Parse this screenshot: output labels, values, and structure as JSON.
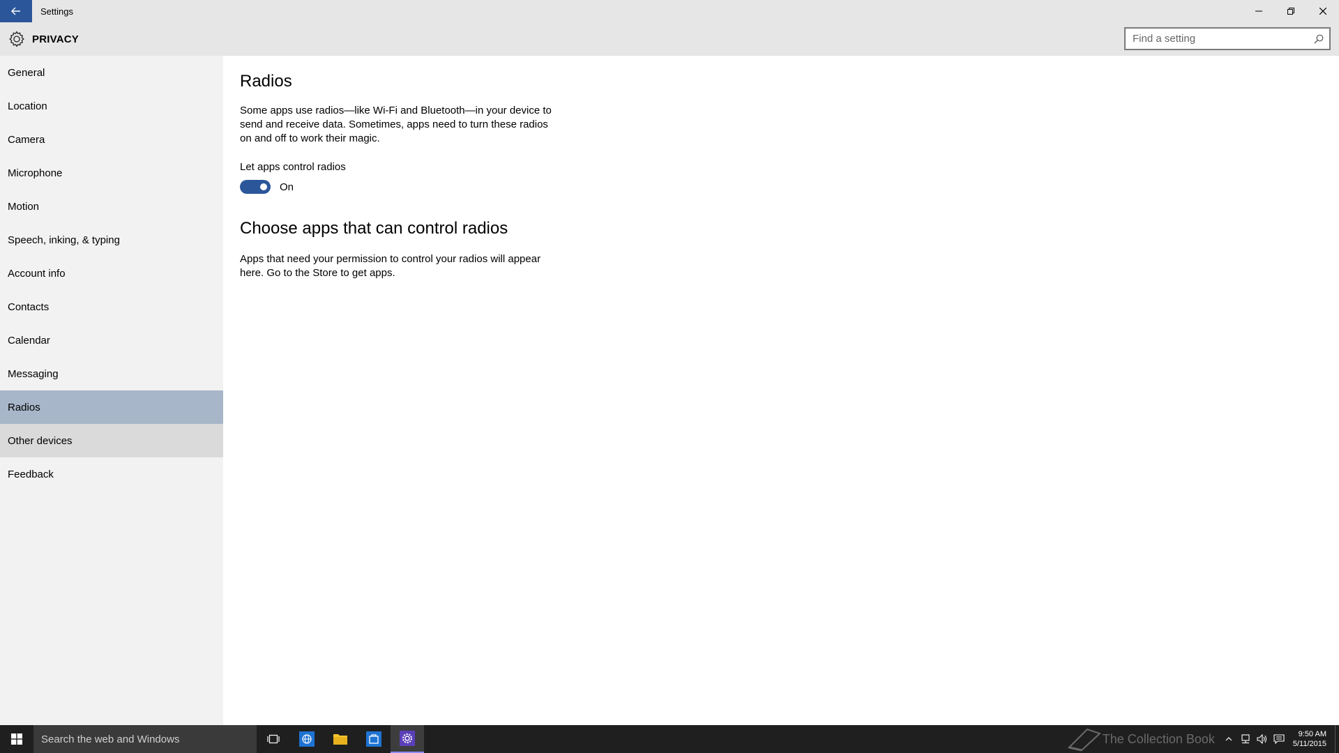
{
  "window": {
    "title": "Settings"
  },
  "header": {
    "title": "PRIVACY",
    "search_placeholder": "Find a setting"
  },
  "sidebar": {
    "items": [
      {
        "label": "General"
      },
      {
        "label": "Location"
      },
      {
        "label": "Camera"
      },
      {
        "label": "Microphone"
      },
      {
        "label": "Motion"
      },
      {
        "label": "Speech, inking, & typing"
      },
      {
        "label": "Account info"
      },
      {
        "label": "Contacts"
      },
      {
        "label": "Calendar"
      },
      {
        "label": "Messaging"
      },
      {
        "label": "Radios"
      },
      {
        "label": "Other devices"
      },
      {
        "label": "Feedback"
      }
    ],
    "selected": "Radios",
    "hovered": "Other devices"
  },
  "main": {
    "title": "Radios",
    "description": "Some apps use radios—like Wi-Fi and Bluetooth—in your device to send and receive data. Sometimes, apps need to turn these radios on and off to work their magic.",
    "toggle_label": "Let apps control radios",
    "toggle_state": "On",
    "section_title": "Choose apps that can control radios",
    "section_description": "Apps that need your permission to control your radios will appear here. Go to the Store to get apps."
  },
  "taskbar": {
    "search_text": "Search the web and Windows",
    "time": "9:50 AM",
    "date": "5/11/2015",
    "watermark": "The Collection Book"
  },
  "colors": {
    "accent": "#2b579a",
    "selected_item": "#a7b6c8",
    "sidebar_bg": "#f2f2f2",
    "titlebar_bg": "#e6e6e6",
    "taskbar_bg": "#1f1f1f"
  }
}
